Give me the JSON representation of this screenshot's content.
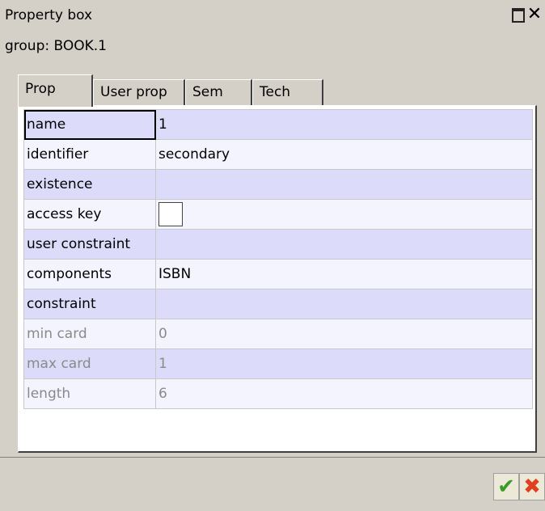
{
  "window": {
    "title": "Property box",
    "restore_icon": "restore-icon",
    "close_icon": "close-icon",
    "close_glyph": "✕",
    "group_label": "group: BOOK.1"
  },
  "tabs": [
    {
      "label": "Prop",
      "active": true
    },
    {
      "label": "User prop",
      "active": false
    },
    {
      "label": "Sem",
      "active": false
    },
    {
      "label": "Tech",
      "active": false
    }
  ],
  "properties": [
    {
      "key": "name",
      "value": "1",
      "selected": true,
      "disabled": false
    },
    {
      "key": "identifier",
      "value": "secondary",
      "disabled": false
    },
    {
      "key": "existence",
      "value": "",
      "disabled": false
    },
    {
      "key": "access key",
      "value": "",
      "type": "checkbox",
      "checked": false,
      "disabled": false
    },
    {
      "key": "user constraint",
      "value": "",
      "disabled": false
    },
    {
      "key": "components",
      "value": "ISBN",
      "disabled": false
    },
    {
      "key": "constraint",
      "value": "",
      "disabled": false
    },
    {
      "key": "min card",
      "value": "0",
      "disabled": true
    },
    {
      "key": "max card",
      "value": "1",
      "disabled": true
    },
    {
      "key": "length",
      "value": "6",
      "disabled": true
    }
  ],
  "buttons": {
    "ok_glyph": "✔",
    "cancel_glyph": "✖"
  },
  "colors": {
    "window_bg": "#d4d0c8",
    "row_odd": "#dcdcfa",
    "row_even": "#f4f4ff",
    "disabled_text": "#8a8a8a",
    "ok_green": "#3b9a2a",
    "cancel_red": "#e04020"
  }
}
